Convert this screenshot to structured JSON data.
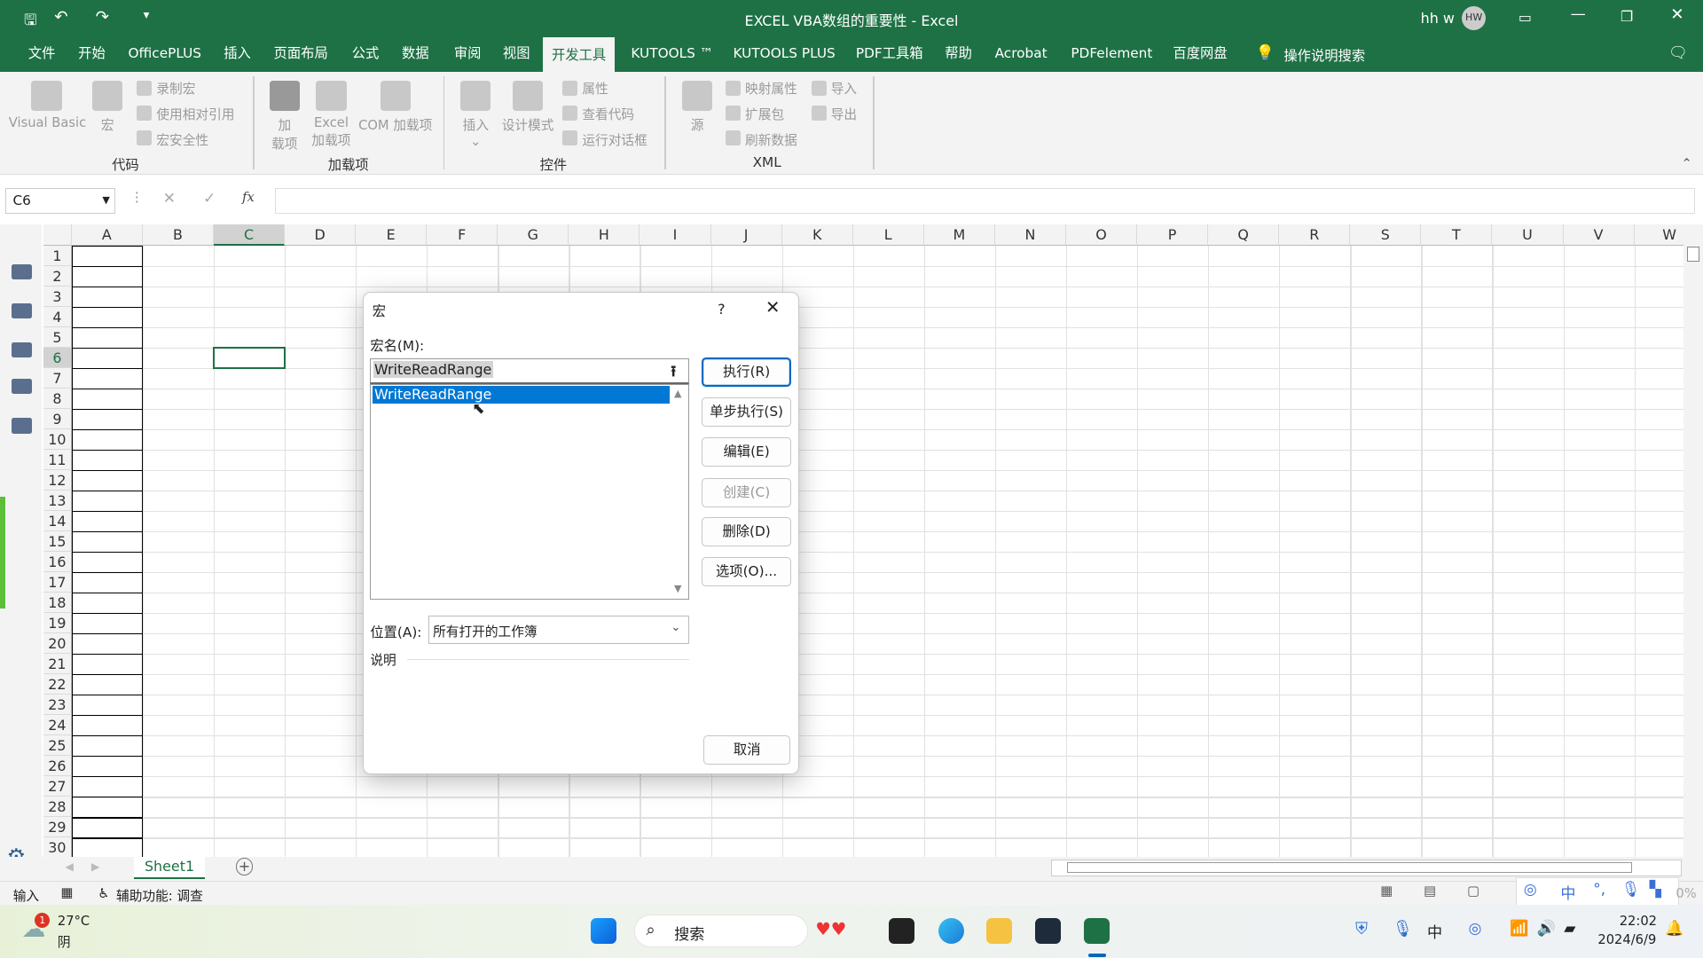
{
  "window": {
    "title": "EXCEL VBA数组的重要性  -  Excel",
    "user": "hh w",
    "avatar": "HW"
  },
  "tabs": [
    "文件",
    "开始",
    "OfficePLUS",
    "插入",
    "页面布局",
    "公式",
    "数据",
    "审阅",
    "视图",
    "开发工具",
    "KUTOOLS ™",
    "KUTOOLS PLUS",
    "PDF工具箱",
    "帮助",
    "Acrobat",
    "PDFelement",
    "百度网盘"
  ],
  "active_tab": "开发工具",
  "tell_me": "操作说明搜索",
  "ribbon": {
    "code": {
      "label": "代码",
      "visual_basic": "Visual Basic",
      "macros": "宏",
      "record": "录制宏",
      "relative": "使用相对引用",
      "security": "宏安全性"
    },
    "addins": {
      "label": "加载项",
      "addins_1": "加",
      "addins_2": "载项",
      "excel_1": "Excel",
      "excel_2": "加载项",
      "com": "COM 加载项"
    },
    "controls": {
      "label": "控件",
      "insert": "插入",
      "design": "设计模式",
      "properties": "属性",
      "view_code": "查看代码",
      "run_dialog": "运行对话框"
    },
    "xml": {
      "label": "XML",
      "source": "源",
      "map_props": "映射属性",
      "expansion": "扩展包",
      "refresh": "刷新数据",
      "import": "导入",
      "export": "导出"
    }
  },
  "formula_bar": {
    "name_box": "C6",
    "formula": "",
    "fx": "fx"
  },
  "grid": {
    "columns": [
      "A",
      "B",
      "C",
      "D",
      "E",
      "F",
      "G",
      "H",
      "I",
      "J",
      "K",
      "L",
      "M",
      "N",
      "O",
      "P",
      "Q",
      "R",
      "S",
      "T",
      "U",
      "V",
      "W"
    ],
    "rows": [
      "1",
      "2",
      "3",
      "4",
      "5",
      "6",
      "7",
      "8",
      "9",
      "10",
      "11",
      "12",
      "13",
      "14",
      "15",
      "16",
      "17",
      "18",
      "19",
      "20",
      "21",
      "22",
      "23",
      "24",
      "25",
      "26",
      "27",
      "28",
      "29",
      "30"
    ],
    "selected_cell": "C6"
  },
  "dialog": {
    "title": "宏",
    "help": "?",
    "name_label": "宏名(M):",
    "name_value": "WriteReadRange",
    "macros": [
      "WriteReadRange"
    ],
    "selected_macro": "WriteReadRange",
    "buttons": {
      "run": "执行(R)",
      "step": "单步执行(S)",
      "edit": "编辑(E)",
      "create": "创建(C)",
      "delete": "删除(D)",
      "options": "选项(O)...",
      "cancel": "取消"
    },
    "location_label": "位置(A):",
    "location_value": "所有打开的工作簿",
    "description_label": "说明"
  },
  "sheets": [
    "Sheet1"
  ],
  "status": {
    "mode": "输入",
    "accessibility": "辅助功能: 调查",
    "zoom": "0%"
  },
  "taskbar": {
    "weather_temp": "27°C",
    "weather_desc": "阴",
    "weather_badge": "1",
    "search": "搜索",
    "time": "22:02",
    "date": "2024/6/9"
  },
  "colors": {
    "excel_green": "#1e7145",
    "selection": "#0078d4"
  }
}
